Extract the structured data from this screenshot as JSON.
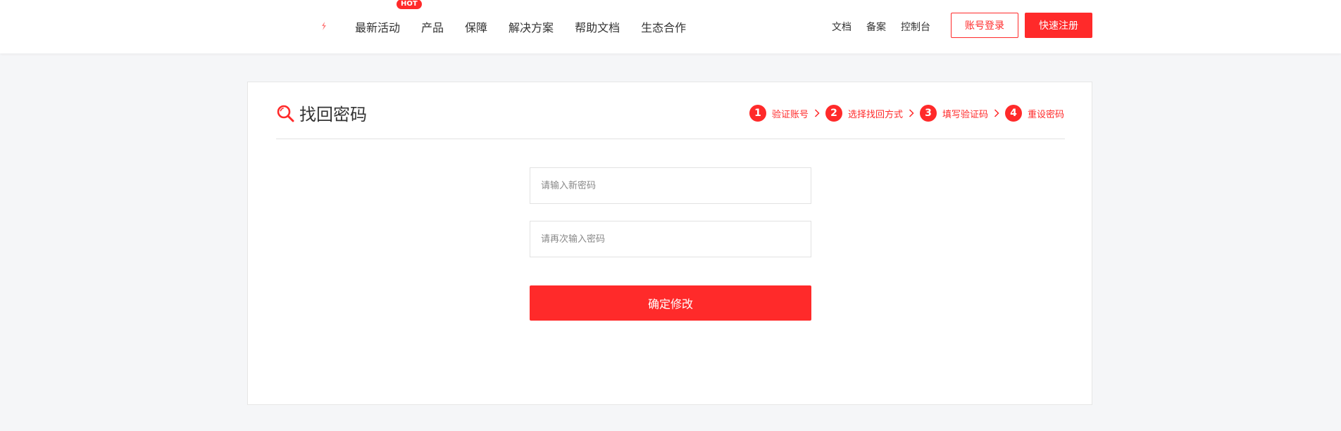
{
  "header": {
    "nav": [
      {
        "label": "最新活动",
        "badge": "HOT"
      },
      {
        "label": "产品"
      },
      {
        "label": "保障"
      },
      {
        "label": "解决方案"
      },
      {
        "label": "帮助文档"
      },
      {
        "label": "生态合作"
      }
    ],
    "links": [
      "文档",
      "备案",
      "控制台"
    ],
    "login_label": "账号登录",
    "register_label": "快速注册"
  },
  "page": {
    "title": "找回密码",
    "title_icon": "search-icon",
    "steps": [
      {
        "num": "1",
        "label": "验证账号"
      },
      {
        "num": "2",
        "label": "选择找回方式"
      },
      {
        "num": "3",
        "label": "填写验证码"
      },
      {
        "num": "4",
        "label": "重设密码"
      }
    ]
  },
  "form": {
    "new_password": {
      "value": "",
      "placeholder": "请输入新密码"
    },
    "confirm_password": {
      "value": "",
      "placeholder": "请再次输入密码"
    },
    "submit_label": "确定修改"
  },
  "colors": {
    "accent": "#ff2a2a",
    "background": "#f5f6f8",
    "text": "#333333"
  }
}
